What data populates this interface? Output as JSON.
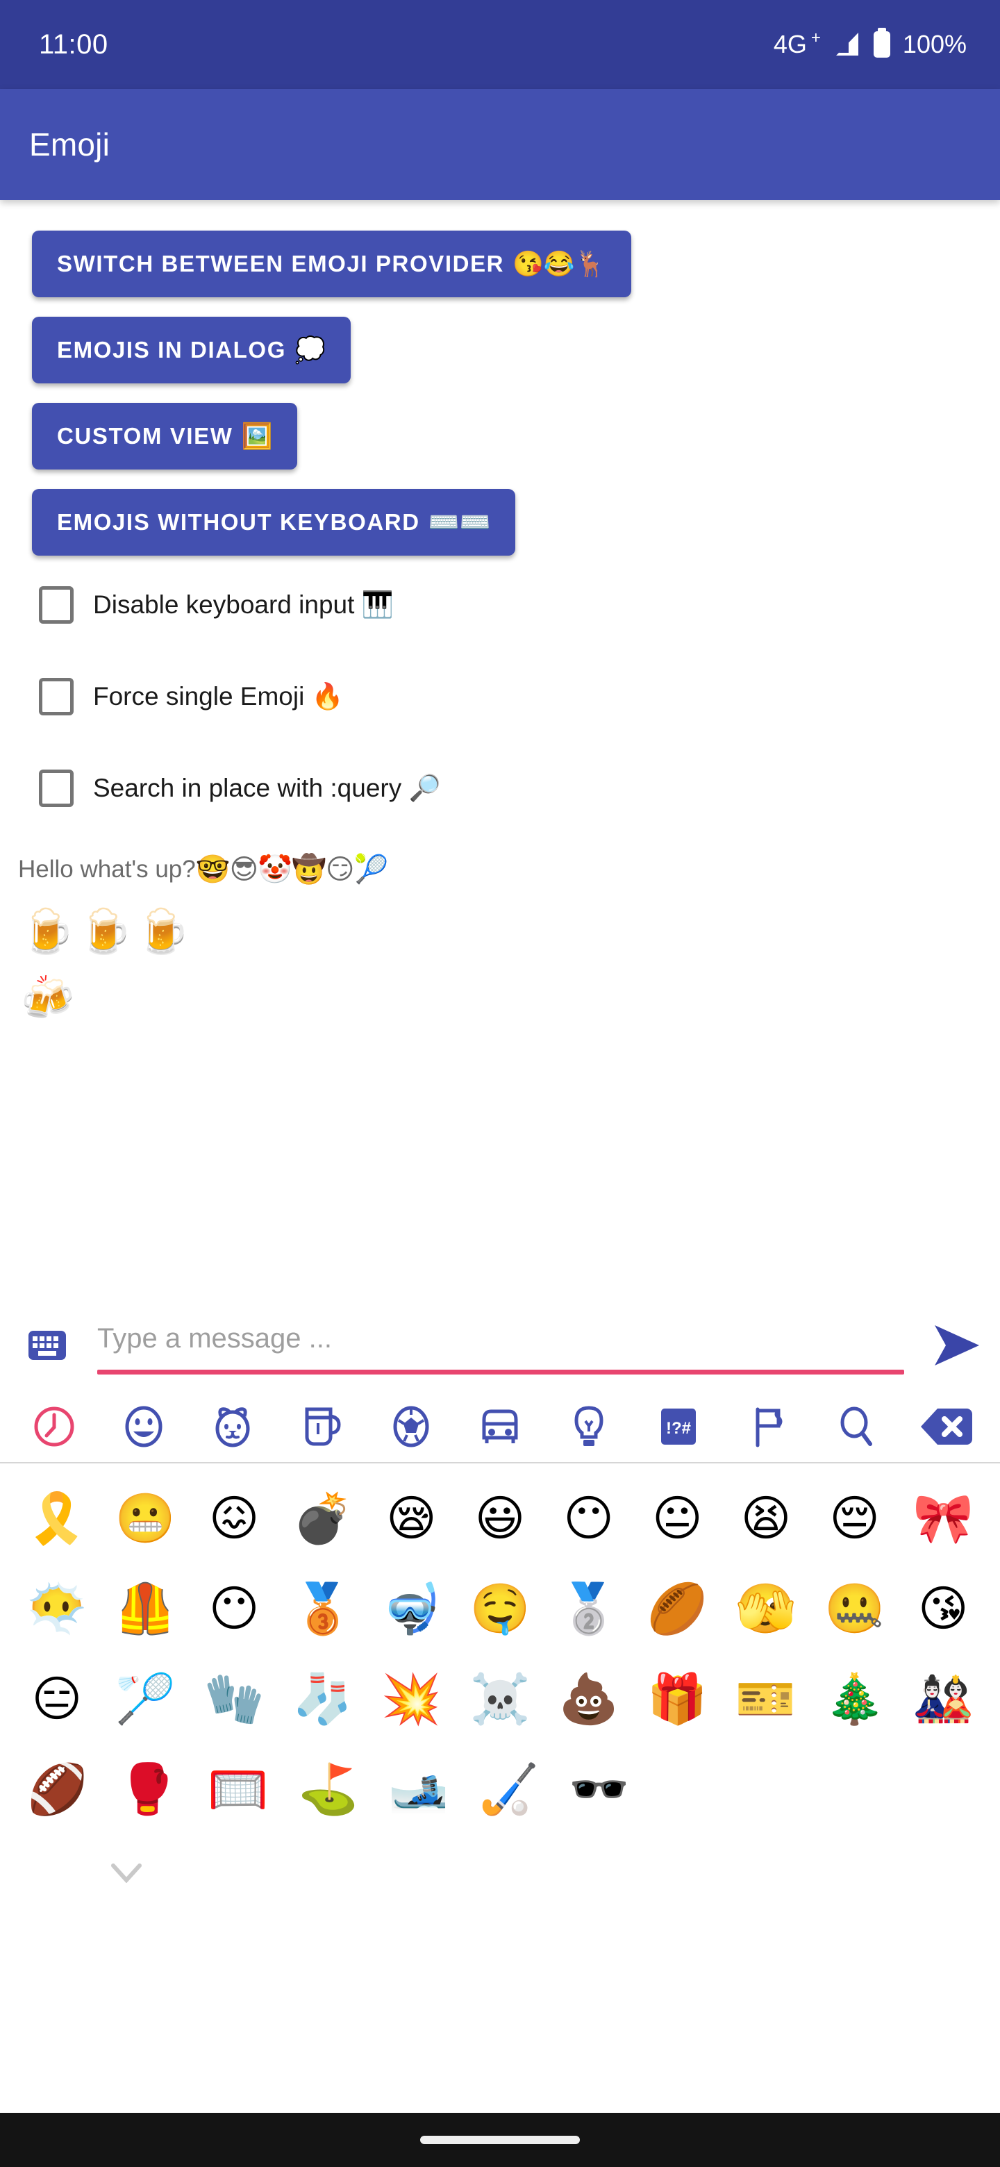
{
  "status_bar": {
    "time": "11:00",
    "network": "4G",
    "network_sup": "+",
    "battery_percent": "100%",
    "icons": {
      "signal": "signal-bars-icon",
      "battery": "battery-full-icon"
    }
  },
  "app_bar": {
    "title": "Emoji"
  },
  "buttons": [
    {
      "label": "SWITCH BETWEEN EMOJI PROVIDER",
      "emoji": "😘😂🦌",
      "name": "switch-emoji-provider-button"
    },
    {
      "label": "EMOJIS IN DIALOG",
      "emoji": "💭",
      "name": "emojis-in-dialog-button"
    },
    {
      "label": "CUSTOM VIEW",
      "emoji": "🖼️",
      "name": "custom-view-button"
    },
    {
      "label": "EMOJIS WITHOUT KEYBOARD",
      "emoji": "⌨️⌨️",
      "name": "emojis-without-keyboard-button"
    }
  ],
  "checkboxes": [
    {
      "label": "Disable keyboard input",
      "emoji": "🎹",
      "checked": false,
      "name": "checkbox-disable-keyboard-input"
    },
    {
      "label": "Force single Emoji",
      "emoji": "🔥",
      "checked": false,
      "name": "checkbox-force-single-emoji"
    },
    {
      "label": "Search in place with :query",
      "emoji": "🔎",
      "checked": false,
      "name": "checkbox-search-in-place"
    }
  ],
  "hello": {
    "text": "Hello what's up?",
    "emoji": "🤓😎🤡🤠😏🎾"
  },
  "emoji_samples": {
    "line1": "🍺🍺🍺",
    "line2": "🍻"
  },
  "input_row": {
    "keyboard_icon": "keyboard-icon",
    "placeholder": "Type a message ...",
    "value": "",
    "send_icon": "send-icon",
    "underline_color": "#E8456F"
  },
  "emoji_tabs": [
    {
      "name": "tab-recent",
      "icon": "clock-icon",
      "selected": true
    },
    {
      "name": "tab-smileys",
      "icon": "smiley-icon",
      "selected": false
    },
    {
      "name": "tab-animals",
      "icon": "animal-face-icon",
      "selected": false
    },
    {
      "name": "tab-food",
      "icon": "beverage-cup-icon",
      "selected": false
    },
    {
      "name": "tab-activities",
      "icon": "soccer-ball-icon",
      "selected": false
    },
    {
      "name": "tab-travel",
      "icon": "car-icon",
      "selected": false
    },
    {
      "name": "tab-objects",
      "icon": "lightbulb-icon",
      "selected": false
    },
    {
      "name": "tab-symbols",
      "icon": "punctuation-symbols-icon",
      "selected": false
    },
    {
      "name": "tab-flags",
      "icon": "flag-icon",
      "selected": false
    },
    {
      "name": "tab-search",
      "icon": "search-icon",
      "selected": false
    },
    {
      "name": "tab-backspace",
      "icon": "backspace-icon",
      "selected": false
    }
  ],
  "emoji_grid": {
    "rows": [
      [
        "🎗️",
        "😬",
        "😖",
        "💣",
        "😪",
        "😃",
        "😶",
        "😐",
        "😫",
        "😔",
        "🎀"
      ],
      [
        "😶‍🌫️",
        "🦺",
        "😶",
        "🥉",
        "🤿",
        "🤤",
        "🥈",
        "🏉",
        "🫣",
        "🤐",
        "😘"
      ],
      [
        "😑",
        "🏸",
        "🧤",
        "🧦",
        "💥",
        "☠️",
        "💩",
        "🎁",
        "🎫",
        "🎄",
        "🎎"
      ],
      [
        "🏈",
        "🥊",
        "🥅",
        "⛳",
        "🎿",
        "🏑",
        "🕶️"
      ]
    ]
  },
  "footer": {
    "chevron_icon": "chevron-down-icon",
    "home_indicator": "home-indicator"
  },
  "colors": {
    "status_bar": "#333D95",
    "app_bar": "#4350B0",
    "button": "#4350B0",
    "accent_pink": "#E8456F",
    "tab_icon": "#4350B0",
    "nav_bar": "#141414"
  }
}
